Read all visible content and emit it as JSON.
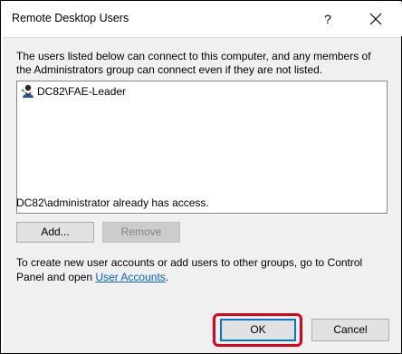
{
  "window": {
    "title": "Remote Desktop Users",
    "help_label": "?"
  },
  "description": "The users listed below can connect to this computer, and any members of the Administrators group can connect even if they are not listed.",
  "users": [
    {
      "name": "DC82\\FAE-Leader",
      "icon": "user-icon"
    }
  ],
  "access_text": "DC82\\administrator already has access.",
  "buttons": {
    "add": "Add...",
    "remove": "Remove",
    "ok": "OK",
    "cancel": "Cancel"
  },
  "info": {
    "text_before": "To create new user accounts or add users to other groups, go to Control Panel and open ",
    "link": "User Accounts",
    "text_after": "."
  },
  "colors": {
    "highlight": "#e0001b",
    "link": "#0066cc",
    "focus": "#0078d7"
  }
}
